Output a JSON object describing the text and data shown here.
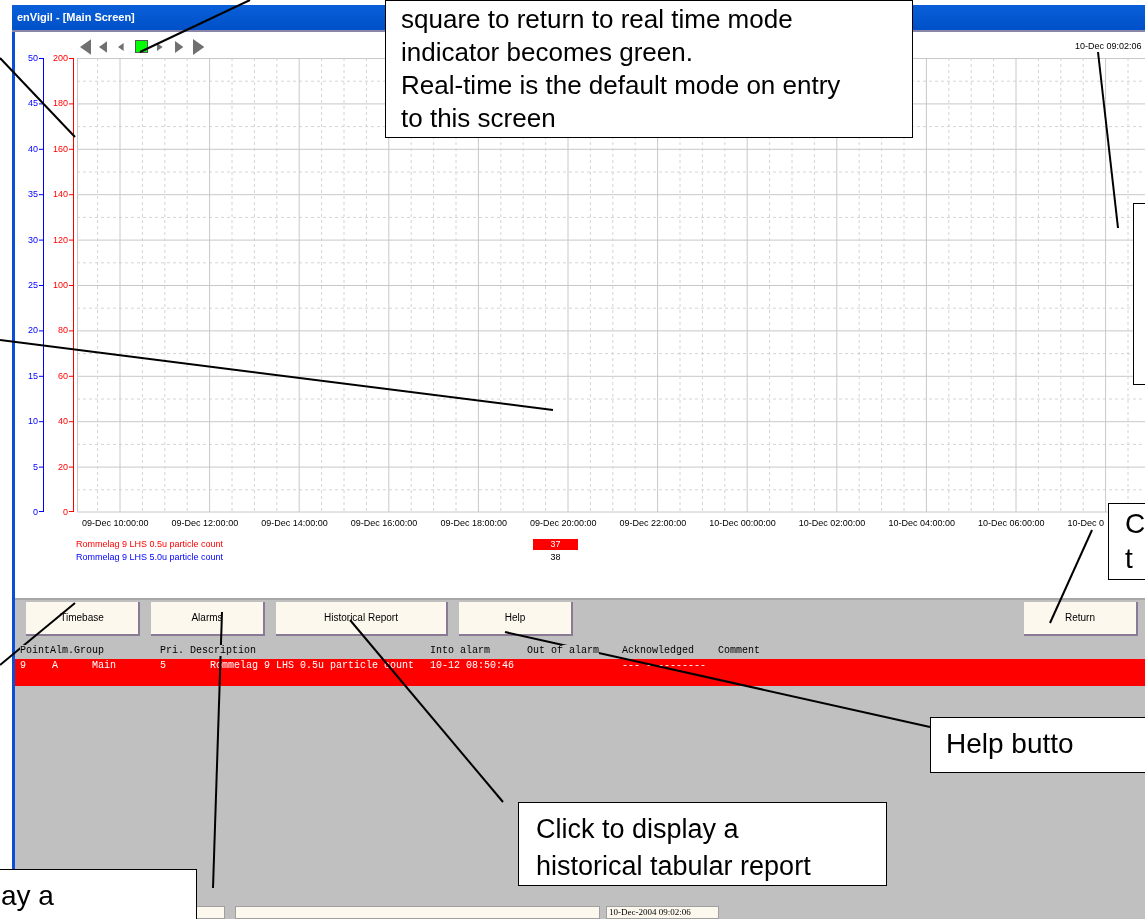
{
  "window": {
    "title": "enVigil - [Main Screen]"
  },
  "realtime_indicator": {
    "on": true
  },
  "timestamp": "10-Dec 09:02:06",
  "chart": {
    "left_axis_ticks": [
      "50",
      "45",
      "40",
      "35",
      "30",
      "25",
      "20",
      "15",
      "10",
      "5",
      "0"
    ],
    "right_axis_ticks": [
      "200",
      "180",
      "160",
      "140",
      "120",
      "100",
      "80",
      "60",
      "40",
      "20",
      "0"
    ],
    "x_labels": [
      "09-Dec 10:00:00",
      "09-Dec 12:00:00",
      "09-Dec 14:00:00",
      "09-Dec 16:00:00",
      "09-Dec 18:00:00",
      "09-Dec 20:00:00",
      "09-Dec 22:00:00",
      "10-Dec 00:00:00",
      "10-Dec 02:00:00",
      "10-Dec 04:00:00",
      "10-Dec 06:00:00",
      "10-Dec 0"
    ],
    "legend": [
      {
        "name": "Rommelag 9 LHS 0.5u particle count",
        "color": "#ff0000",
        "value": "37",
        "alarm": true
      },
      {
        "name": "Rommelag 9 LHS 5.0u particle count",
        "color": "#0000ff",
        "value": "38",
        "alarm": false
      }
    ]
  },
  "buttons_left": [
    "Timebase",
    "Alarms",
    "Historical Report",
    "Help"
  ],
  "buttons_right": [
    "Return"
  ],
  "alarm_table": {
    "columns": [
      "PointAlm.Group",
      "Pri. Description",
      "Into alarm",
      "Out of alarm",
      "Acknowledged",
      "Comment"
    ],
    "rows": [
      {
        "point": "9",
        "alm": "A",
        "group": "Main",
        "pri": "5",
        "description": "Rommelag 9 LHS 0.5u particle count",
        "into_alarm": "10-12 08:50:46",
        "acknowledged": "--- - --------",
        "alarm": true
      }
    ]
  },
  "status_bar": {
    "datetime": "10-Dec-2004 09:02:06"
  },
  "callouts": [
    {
      "kind": "top",
      "lines": [
        "square to return to real time mode",
        "indicator becomes green.",
        "Real-time is the default mode on entry",
        "to this screen"
      ]
    },
    {
      "kind": "right_empty"
    },
    {
      "kind": "return",
      "lines": [
        "C",
        "t"
      ]
    },
    {
      "kind": "help",
      "lines": [
        "Help butto"
      ]
    },
    {
      "kind": "historical",
      "lines": [
        "Click to display a",
        "historical tabular report"
      ]
    },
    {
      "kind": "alarms",
      "lines": [
        "ay a"
      ]
    }
  ]
}
